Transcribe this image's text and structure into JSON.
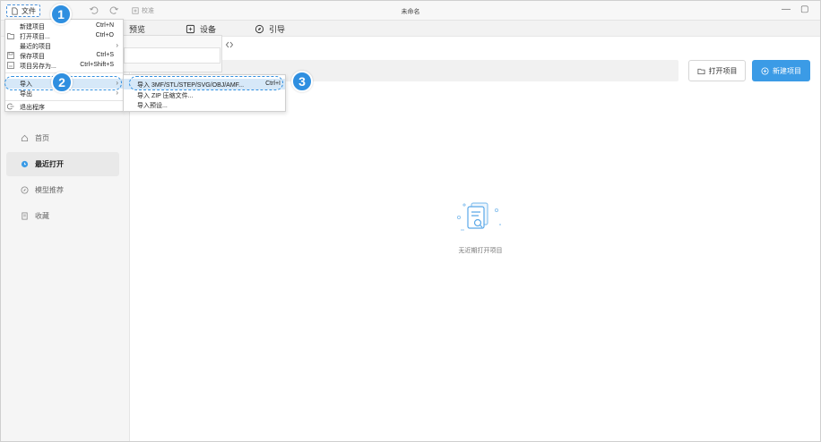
{
  "titlebar": {
    "file_label": "文件",
    "calibrate_label": "校准",
    "window_title": "未命名",
    "minimize": "—",
    "maximize": "▢"
  },
  "toolbar2": {
    "preview_label": "预览",
    "device_label": "设备",
    "guide_label": "引导"
  },
  "file_menu": {
    "items": [
      {
        "label": "新建项目",
        "shortcut": "Ctrl+N"
      },
      {
        "label": "打开项目...",
        "shortcut": "Ctrl+O"
      },
      {
        "label": "最近的项目",
        "arrow": "›"
      },
      {
        "label": "保存项目",
        "shortcut": "Ctrl+S"
      },
      {
        "label": "项目另存为...",
        "shortcut": "Ctrl+Shift+S"
      },
      {
        "label": "导入",
        "arrow": "›"
      },
      {
        "label": "导出",
        "arrow": "›"
      },
      {
        "label": "退出程序"
      }
    ]
  },
  "import_submenu": {
    "items": [
      {
        "label": "导入 3MF/STL/STEP/SVG/OBJ/AMF...",
        "shortcut": "Ctrl+I"
      },
      {
        "label": "导入 ZIP 压缩文件..."
      },
      {
        "label": "导入预设..."
      }
    ]
  },
  "sidebar": {
    "items": [
      {
        "label": "首页"
      },
      {
        "label": "最近打开"
      },
      {
        "label": "模型推荐"
      },
      {
        "label": "收藏"
      }
    ]
  },
  "main": {
    "open_project_label": "打开项目",
    "new_project_label": "新建项目",
    "empty_text": "无近期打开项目"
  },
  "steps": [
    "1",
    "2",
    "3"
  ],
  "colors": {
    "accent": "#2f8fe0",
    "primary_button": "#3b9be6",
    "menu_highlight": "#d6e8f8"
  }
}
